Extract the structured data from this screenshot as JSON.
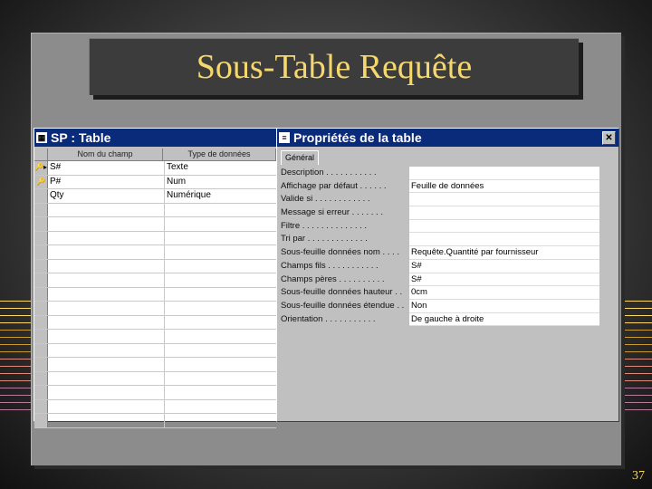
{
  "slide": {
    "title": "Sous-Table Requête",
    "page_number": "37"
  },
  "colors": {
    "title_text": "#f5d76e",
    "deco_lines": [
      "#ffd966",
      "#c89a2e",
      "#e08a7a",
      "#b87a9a"
    ]
  },
  "table_window": {
    "title": "SP : Table",
    "icon": "table-icon",
    "columns": [
      "Nom du champ",
      "Type de données"
    ],
    "rows": [
      {
        "marker": "🔑▸",
        "field": "S#",
        "type": "Texte"
      },
      {
        "marker": "🔑",
        "field": "P#",
        "type": "Num"
      },
      {
        "marker": "",
        "field": "Qty",
        "type": "Numérique"
      },
      {
        "marker": "",
        "field": "",
        "type": ""
      },
      {
        "marker": "",
        "field": "",
        "type": ""
      },
      {
        "marker": "",
        "field": "",
        "type": ""
      },
      {
        "marker": "",
        "field": "",
        "type": ""
      },
      {
        "marker": "",
        "field": "",
        "type": ""
      },
      {
        "marker": "",
        "field": "",
        "type": ""
      },
      {
        "marker": "",
        "field": "",
        "type": ""
      },
      {
        "marker": "",
        "field": "",
        "type": ""
      },
      {
        "marker": "",
        "field": "",
        "type": ""
      },
      {
        "marker": "",
        "field": "",
        "type": ""
      },
      {
        "marker": "",
        "field": "",
        "type": ""
      },
      {
        "marker": "",
        "field": "",
        "type": ""
      },
      {
        "marker": "",
        "field": "",
        "type": ""
      },
      {
        "marker": "",
        "field": "",
        "type": ""
      },
      {
        "marker": "",
        "field": "",
        "type": ""
      },
      {
        "marker": "",
        "field": "",
        "type": ""
      }
    ]
  },
  "props_window": {
    "title": "Propriétés de la table",
    "icon": "properties-icon",
    "close": "✕",
    "tab": "Général",
    "rows": [
      {
        "label": "Description . . . . . . . . . . .",
        "value": ""
      },
      {
        "label": "Affichage par défaut . . . . . .",
        "value": "Feuille de données"
      },
      {
        "label": "Valide si . . . . . . . . . . . .",
        "value": ""
      },
      {
        "label": "Message si erreur . . . . . . .",
        "value": ""
      },
      {
        "label": "Filtre . . . . . . . . . . . . . .",
        "value": ""
      },
      {
        "label": "Tri par . . . . . . . . . . . . .",
        "value": ""
      },
      {
        "label": "Sous-feuille données nom . . . .",
        "value": "Requête.Quantité par fournisseur"
      },
      {
        "label": "Champs fils . . . . . . . . . . .",
        "value": "S#"
      },
      {
        "label": "Champs pères . . . . . . . . . .",
        "value": "S#"
      },
      {
        "label": "Sous-feuille données hauteur . .",
        "value": "0cm"
      },
      {
        "label": "Sous-feuille données étendue . .",
        "value": "Non"
      },
      {
        "label": "Orientation . . . . . . . . . . .",
        "value": "De gauche à droite"
      }
    ]
  }
}
